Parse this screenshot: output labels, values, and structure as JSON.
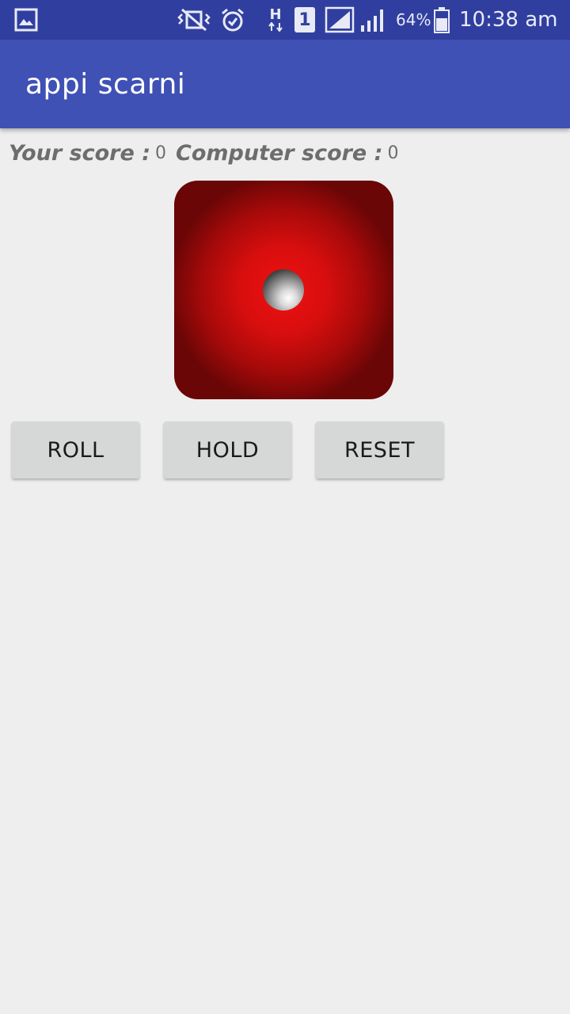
{
  "status_bar": {
    "icons": [
      "gallery-notification-icon",
      "vibrate-mute-icon",
      "alarm-icon",
      "hspa-data-icon",
      "sim1-icon",
      "signal-sim1-icon",
      "signal-sim2-icon",
      "battery-icon"
    ],
    "network_type": "H",
    "sim_slot": "1",
    "battery_percent": "64%",
    "time": "10:38 am"
  },
  "app_bar": {
    "title": "appi scarni",
    "color": "#3f51b5"
  },
  "scores": {
    "your_label": "Your score :",
    "your_value": "0",
    "computer_label": "Computer score :",
    "computer_value": "0"
  },
  "die": {
    "face_value": 1,
    "color": "#e01010"
  },
  "buttons": {
    "roll": "ROLL",
    "hold": "HOLD",
    "reset": "RESET"
  }
}
